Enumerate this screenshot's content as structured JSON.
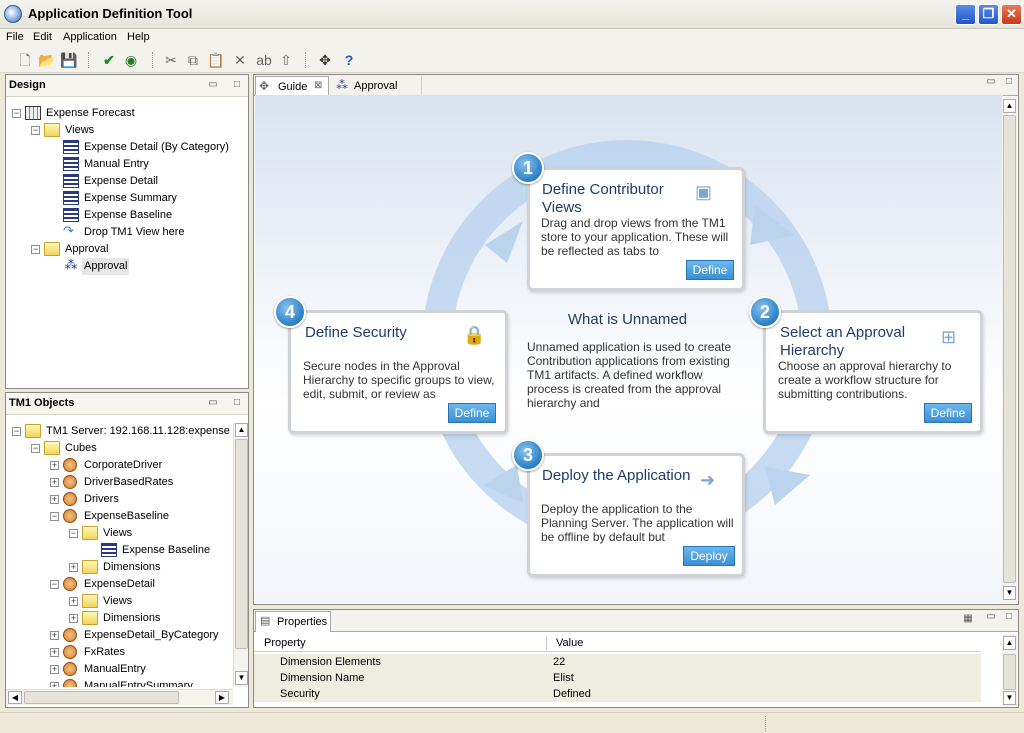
{
  "window": {
    "title": "Application Definition Tool"
  },
  "menu": [
    "File",
    "Edit",
    "Application",
    "Help"
  ],
  "design_panel": {
    "title": "Design",
    "tree": [
      {
        "label": "Expense Forecast",
        "level": 0,
        "icon": "app-icon",
        "expand": "−"
      },
      {
        "label": "Views",
        "level": 1,
        "icon": "folder-icon",
        "expand": "−"
      },
      {
        "label": "Expense Detail (By Category)",
        "level": 2,
        "icon": "view-icon"
      },
      {
        "label": "Manual Entry",
        "level": 2,
        "icon": "view-icon"
      },
      {
        "label": "Expense Detail",
        "level": 2,
        "icon": "view-icon"
      },
      {
        "label": "Expense Summary",
        "level": 2,
        "icon": "view-icon"
      },
      {
        "label": "Expense Baseline",
        "level": 2,
        "icon": "view-icon"
      },
      {
        "label": "Drop TM1 View here",
        "level": 2,
        "icon": "drop-arrow-icon"
      },
      {
        "label": "Approval",
        "level": 1,
        "icon": "folder-icon",
        "expand": "−"
      },
      {
        "label": "Approval",
        "level": 2,
        "icon": "approval-hierarchy-icon",
        "selected": true
      }
    ]
  },
  "tm1_panel": {
    "title": "TM1 Objects",
    "tree": [
      {
        "label": "TM1 Server: 192.168.11.128:expense",
        "level": 0,
        "icon": "folder-icon",
        "expand": "−"
      },
      {
        "label": "Cubes",
        "level": 1,
        "icon": "folder-icon",
        "expand": "−"
      },
      {
        "label": "CorporateDriver",
        "level": 2,
        "icon": "cube-icon",
        "expand": "+"
      },
      {
        "label": "DriverBasedRates",
        "level": 2,
        "icon": "cube-icon",
        "expand": "+"
      },
      {
        "label": "Drivers",
        "level": 2,
        "icon": "cube-icon",
        "expand": "+"
      },
      {
        "label": "ExpenseBaseline",
        "level": 2,
        "icon": "cube-icon",
        "expand": "−"
      },
      {
        "label": "Views",
        "level": 3,
        "icon": "folder-icon",
        "expand": "−"
      },
      {
        "label": "Expense Baseline",
        "level": 4,
        "icon": "view-icon"
      },
      {
        "label": "Dimensions",
        "level": 3,
        "icon": "folder-icon",
        "expand": "+"
      },
      {
        "label": "ExpenseDetail",
        "level": 2,
        "icon": "cube-icon",
        "expand": "−"
      },
      {
        "label": "Views",
        "level": 3,
        "icon": "folder-icon",
        "expand": "+"
      },
      {
        "label": "Dimensions",
        "level": 3,
        "icon": "folder-icon",
        "expand": "+"
      },
      {
        "label": "ExpenseDetail_ByCategory",
        "level": 2,
        "icon": "cube-icon",
        "expand": "+"
      },
      {
        "label": "FxRates",
        "level": 2,
        "icon": "cube-icon",
        "expand": "+"
      },
      {
        "label": "ManualEntry",
        "level": 2,
        "icon": "cube-icon",
        "expand": "+"
      },
      {
        "label": "ManualEntrySummary",
        "level": 2,
        "icon": "cube-icon",
        "expand": "+"
      }
    ]
  },
  "tabs": [
    {
      "label": "Guide",
      "active": true
    },
    {
      "label": "Approval",
      "active": false
    }
  ],
  "guide": {
    "center_title": "What is Unnamed",
    "center_body": "Unnamed application is used to create Contribution applications from existing TM1 artifacts. A defined workflow process is created from the approval hierarchy and",
    "steps": [
      {
        "num": "1",
        "title": "Define Contributor Views",
        "body": "Drag and drop views from the TM1 store to your application. These will be reflected as tabs to",
        "button": "Define"
      },
      {
        "num": "2",
        "title": "Select an Approval Hierarchy",
        "body": "Choose an approval hierarchy to create a workflow structure for submitting contributions.",
        "button": "Define"
      },
      {
        "num": "3",
        "title": "Deploy the Application",
        "body": "Deploy the application to the Planning Server. The application will be offline by default but",
        "button": "Deploy"
      },
      {
        "num": "4",
        "title": "Define Security",
        "body": "Secure nodes in the Approval Hierarchy to specific groups to view, edit, submit, or review as",
        "button": "Define"
      }
    ]
  },
  "properties": {
    "tab_label": "Properties",
    "columns": [
      "Property",
      "Value"
    ],
    "rows": [
      {
        "property": "Dimension Elements",
        "value": "22"
      },
      {
        "property": "Dimension Name",
        "value": "Elist"
      },
      {
        "property": "Security",
        "value": "Defined"
      }
    ]
  }
}
